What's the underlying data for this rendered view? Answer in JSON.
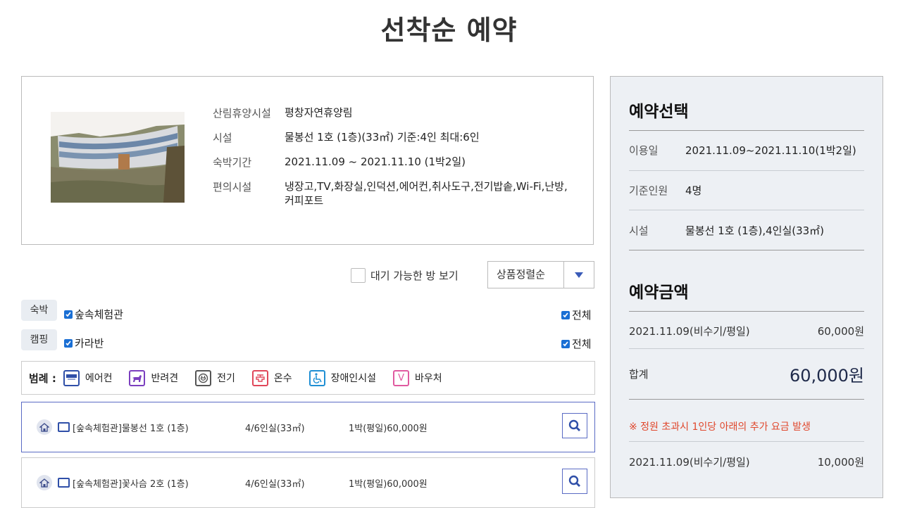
{
  "page_title": "선착순 예약",
  "info": {
    "rows": [
      {
        "key": "산림휴양시설",
        "value": "평창자연휴양림"
      },
      {
        "key": "시설",
        "value": "물봉선 1호 (1층)(33㎡) 기준:4인 최대:6인"
      },
      {
        "key": "숙박기간",
        "value": "2021.11.09 ~ 2021.11.10 (1박2일)"
      },
      {
        "key": "편의시설",
        "value": "냉장고,TV,화장실,인덕션,에어컨,취사도구,전기밥솥,Wi-Fi,난방,커피포트"
      }
    ]
  },
  "filters": {
    "waitlist_label": "대기 가능한 방 보기",
    "sort_value": "상품정렬순"
  },
  "categories": [
    {
      "tag": "숙박",
      "option": "숲속체험관",
      "all_label": "전체"
    },
    {
      "tag": "캠핑",
      "option": "카라반",
      "all_label": "전체"
    }
  ],
  "legend": {
    "title": "범례 :",
    "items": [
      {
        "label": "에어컨",
        "icon": "air-conditioner-icon",
        "color": "#2f4fa8"
      },
      {
        "label": "반려견",
        "icon": "dog-icon",
        "color": "#7b3fbf"
      },
      {
        "label": "전기",
        "icon": "plug-icon",
        "color": "#555555"
      },
      {
        "label": "온수",
        "icon": "hot-water-icon",
        "color": "#e0475a"
      },
      {
        "label": "장애인시설",
        "icon": "wheelchair-icon",
        "color": "#1f8fd4"
      },
      {
        "label": "바우처",
        "icon": "voucher-icon",
        "color": "#e05aa0"
      }
    ]
  },
  "rooms": [
    {
      "name": "[숲속체험관]물봉선 1호 (1층)",
      "capacity": "4/6인실(33㎡)",
      "price": "1박(평일)60,000원"
    },
    {
      "name": "[숲속체험관]꽃사슴 2호 (1층)",
      "capacity": "4/6인실(33㎡)",
      "price": "1박(평일)60,000원"
    }
  ],
  "side": {
    "selection_title": "예약선택",
    "rows": [
      {
        "key": "이용일",
        "value": "2021.11.09~2021.11.10(1박2일)"
      },
      {
        "key": "기준인원",
        "value": "4명"
      },
      {
        "key": "시설",
        "value": "물봉선 1호 (1층),4인실(33㎡)"
      }
    ],
    "amount_title": "예약금액",
    "price_line": {
      "date": "2021.11.09(비수기/평일)",
      "amount": "60,000원"
    },
    "total_label": "합계",
    "total_value": "60,000원",
    "notice": "※ 정원 초과시 1인당 아래의 추가 요금 발생",
    "extra_line": {
      "date": "2021.11.09(비수기/평일)",
      "amount": "10,000원"
    }
  },
  "colors": {
    "accent": "#5a6bc4",
    "notice": "#e0472c",
    "panel": "#edf0f4"
  }
}
